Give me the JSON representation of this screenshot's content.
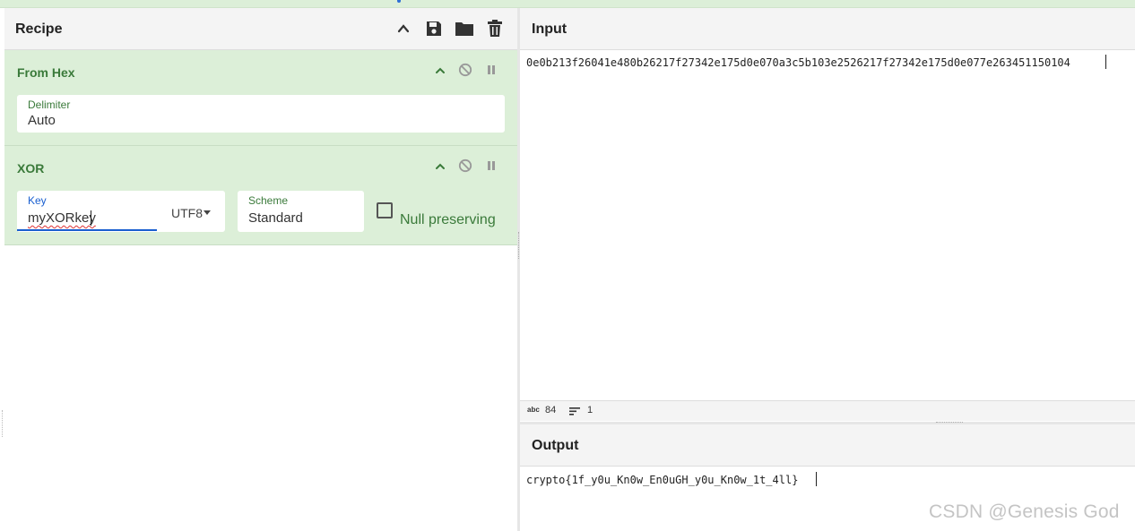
{
  "recipe": {
    "title": "Recipe",
    "operations": [
      {
        "name": "From Hex",
        "fields": {
          "delimiter_label": "Delimiter",
          "delimiter_value": "Auto"
        }
      },
      {
        "name": "XOR",
        "fields": {
          "key_label": "Key",
          "key_value": "myXORkey",
          "key_encoding": "UTF8",
          "scheme_label": "Scheme",
          "scheme_value": "Standard",
          "null_preserving_label": "Null preserving"
        }
      }
    ]
  },
  "input": {
    "title": "Input",
    "text": "0e0b213f26041e480b26217f27342e175d0e070a3c5b103e2526217f27342e175d0e077e263451150104",
    "status_chars_label": "abc",
    "status_chars": "84",
    "status_lines": "1"
  },
  "output": {
    "title": "Output",
    "text": "crypto{1f_y0u_Kn0w_En0uGH_y0u_Kn0w_1t_4ll}"
  },
  "watermark": "CSDN @Genesis God",
  "colors": {
    "op_bg": "#dcefd8",
    "op_title": "#3a7a3a",
    "focus_underline": "#1a5fd0"
  }
}
